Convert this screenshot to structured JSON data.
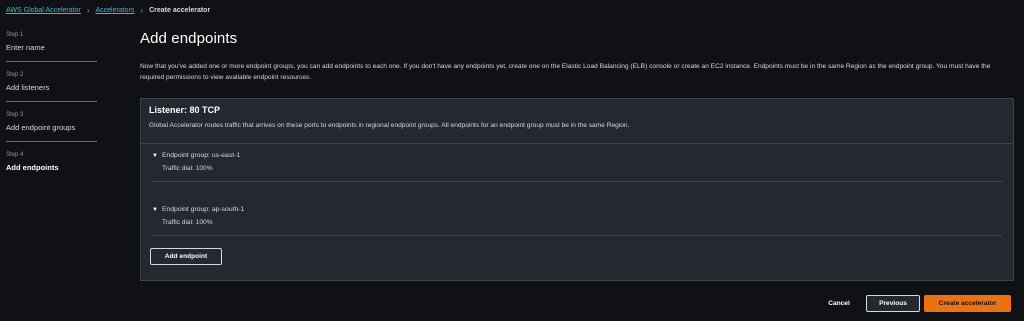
{
  "breadcrumb": {
    "items": [
      "AWS Global Accelerator",
      "Accelerators"
    ],
    "current": "Create accelerator"
  },
  "steps": [
    {
      "num": "Step 1",
      "name": "Enter name"
    },
    {
      "num": "Step 2",
      "name": "Add listeners"
    },
    {
      "num": "Step 3",
      "name": "Add endpoint groups"
    },
    {
      "num": "Step 4",
      "name": "Add endpoints"
    }
  ],
  "main": {
    "title": "Add endpoints",
    "description": "Now that you've added one or more endpoint groups, you can add endpoints to each one. If you don't have any endpoints yet, create one on the Elastic Load Balancing (ELB) console or create an EC2 instance. Endpoints must be in the same Region as the endpoint group. You must have the required permissions to view available endpoint resources."
  },
  "listener": {
    "title": "Listener: 80 TCP",
    "description": "Global Accelerator routes traffic that arrives on these ports to endpoints in regional endpoint groups. All endpoints for an endpoint group must be in the same Region.",
    "groups": [
      {
        "label": "Endpoint group: us-east-1",
        "dial": "Traffic dial: 100%"
      },
      {
        "label": "Endpoint group: ap-south-1",
        "dial": "Traffic dial: 100%"
      }
    ],
    "add_endpoint_label": "Add endpoint"
  },
  "footer": {
    "cancel_label": "Cancel",
    "previous_label": "Previous",
    "create_label": "Create accelerator"
  },
  "colors": {
    "accent": "#ec7211",
    "link": "#44b9d6",
    "background": "#0f1114",
    "panel": "#232831"
  }
}
